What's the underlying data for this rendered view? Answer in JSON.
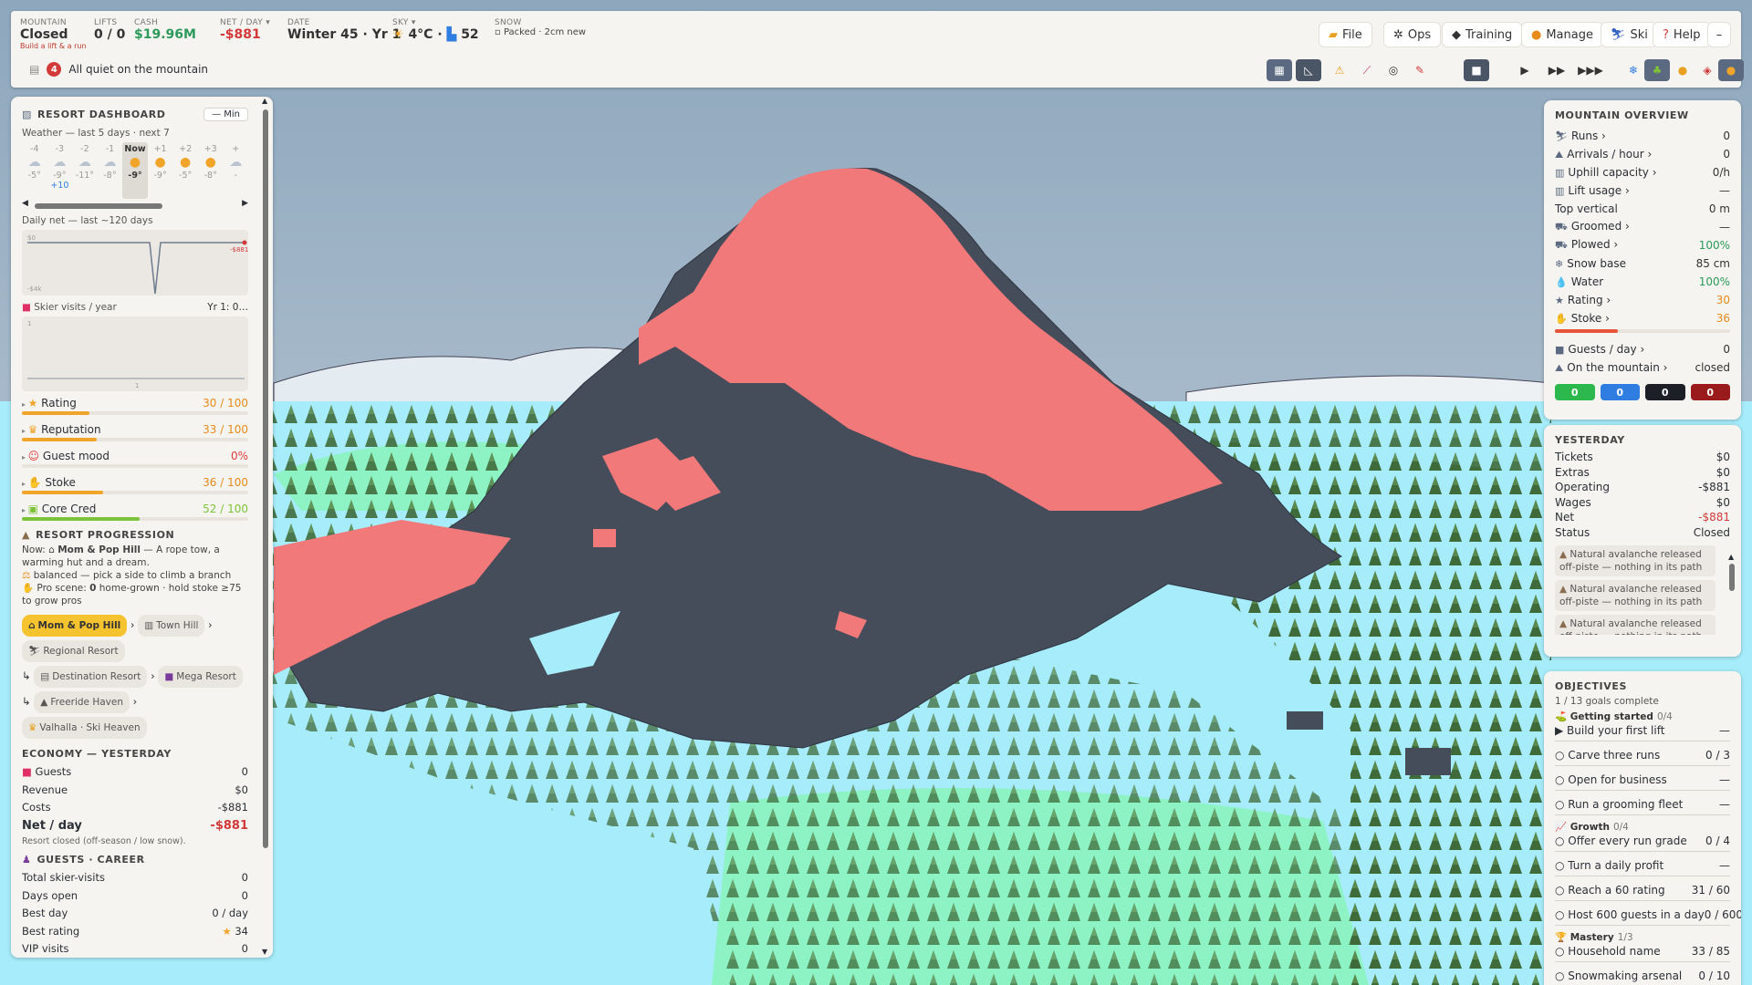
{
  "topbar": {
    "mountain": {
      "label": "MOUNTAIN",
      "value": "Closed",
      "sub": "Build a lift & a run"
    },
    "lifts": {
      "label": "LIFTS",
      "value": "0 / 0"
    },
    "cash": {
      "label": "CASH",
      "value": "$19.96M"
    },
    "net": {
      "label": "NET / DAY",
      "value": "-$881"
    },
    "date": {
      "label": "DATE",
      "value": "Winter 45 · Yr 1"
    },
    "sky": {
      "label": "SKY",
      "temp": "4°C",
      "extra": "52"
    },
    "snow": {
      "label": "SNOW",
      "value": "Packed · 2cm new"
    },
    "status_count": "4",
    "status_text": "All quiet on the mountain",
    "menus": [
      "File",
      "Ops",
      "Training",
      "Manage",
      "Ski",
      "Help"
    ],
    "minimize": "–"
  },
  "dashboard": {
    "title": "RESORT DASHBOARD",
    "min_button": "— Min",
    "weather_caption": "Weather — last 5 days · next 7",
    "weather_days": [
      {
        "day": "-4",
        "temp": "-5°"
      },
      {
        "day": "-3",
        "temp": "-9°"
      },
      {
        "day": "-2",
        "temp": "-11°"
      },
      {
        "day": "-1",
        "temp": "-8°"
      },
      {
        "day": "Now",
        "temp": "-9°"
      },
      {
        "day": "+1",
        "temp": "-9°"
      },
      {
        "day": "+2",
        "temp": "-5°"
      },
      {
        "day": "+3",
        "temp": "-8°"
      },
      {
        "day": "+",
        "temp": "-"
      }
    ],
    "weather_extra": "+10",
    "daily_net_caption": "Daily net — last ~120 days",
    "daily_net_top": "$0",
    "daily_net_bottom": "-$4k",
    "daily_net_last": "-$881",
    "visits_caption": "Skier visits / year",
    "visits_yr": "Yr 1: 0…",
    "visits_axis_top": "1",
    "visits_axis_bottom": "1",
    "meters": [
      {
        "name": "Rating",
        "value": "30 / 100",
        "pct": 0.3,
        "color": "#f0a52a",
        "icon": "★"
      },
      {
        "name": "Reputation",
        "value": "33 / 100",
        "pct": 0.33,
        "color": "#f0a52a",
        "icon": "♛"
      },
      {
        "name": "Guest mood",
        "value": "0%",
        "pct": 0.0,
        "color": "#e03b3b",
        "icon": "☺"
      },
      {
        "name": "Stoke",
        "value": "36 / 100",
        "pct": 0.36,
        "color": "#f0a52a",
        "icon": "✋"
      },
      {
        "name": "Core Cred",
        "value": "52 / 100",
        "pct": 0.52,
        "color": "#7cc33a",
        "icon": "▣"
      }
    ],
    "progression_title": "RESORT PROGRESSION",
    "progression_now_label": "Now:",
    "progression_now_name": "Mom & Pop Hill",
    "progression_now_desc": "— A rope tow, a warming hut and a dream.",
    "progression_balanced": "balanced — pick a side to climb a branch",
    "progression_pro_a": "Pro scene:",
    "progression_pro_b": "0",
    "progression_pro_c": "home-grown · hold stoke ≥75 to grow pros",
    "tiers": {
      "mom_pop": "Mom & Pop Hill",
      "town": "Town Hill",
      "regional": "Regional Resort",
      "destination": "Destination Resort",
      "mega": "Mega Resort",
      "freeride": "Freeride Haven",
      "valhalla": "Valhalla · Ski Heaven"
    },
    "economy_title": "ECONOMY — YESTERDAY",
    "economy": {
      "guests_label": "Guests",
      "guests": "0",
      "revenue_label": "Revenue",
      "revenue": "$0",
      "costs_label": "Costs",
      "costs": "-$881",
      "net_label": "Net / day",
      "net": "-$881"
    },
    "economy_note": "Resort closed (off-season / low snow).",
    "guests_title": "GUESTS · CAREER",
    "career": [
      {
        "label": "Total skier-visits",
        "value": "0"
      },
      {
        "label": "Days open",
        "value": "0"
      },
      {
        "label": "Best day",
        "value": "0 / day"
      },
      {
        "label": "Best rating",
        "value": "34"
      },
      {
        "label": "VIP visits",
        "value": "0"
      }
    ]
  },
  "overview": {
    "title": "MOUNTAIN OVERVIEW",
    "rows": [
      {
        "icon": "⛷",
        "label": "Runs ›",
        "value": "0"
      },
      {
        "icon": "⛰",
        "label": "Arrivals / hour ›",
        "value": "0"
      },
      {
        "icon": "▥",
        "label": "Uphill capacity ›",
        "value": "0/h"
      },
      {
        "icon": "▥",
        "label": "Lift usage ›",
        "value": "—"
      },
      {
        "icon": "",
        "label": "Top vertical",
        "value": "0 m"
      },
      {
        "icon": "⛟",
        "label": "Groomed ›",
        "value": "—"
      },
      {
        "icon": "⛟",
        "label": "Plowed ›",
        "value": "100%"
      },
      {
        "icon": "❄",
        "label": "Snow base",
        "value": "85 cm"
      },
      {
        "icon": "💧",
        "label": "Water",
        "value": "100%"
      },
      {
        "icon": "★",
        "label": "Rating ›",
        "value": "30"
      },
      {
        "icon": "✋",
        "label": "Stoke ›",
        "value": "36"
      }
    ],
    "stoke_pct": 0.36,
    "rows2": [
      {
        "icon": "■",
        "label": "Guests / day ›",
        "value": "0"
      },
      {
        "icon": "⛰",
        "label": "On the mountain ›",
        "value": "closed"
      }
    ],
    "pills": [
      {
        "value": "0",
        "color": "#2db84d"
      },
      {
        "value": "0",
        "color": "#2f7de0"
      },
      {
        "value": "0",
        "color": "#1c1f26"
      },
      {
        "value": "0",
        "color": "#9a1b1b"
      }
    ]
  },
  "yesterday": {
    "title": "YESTERDAY",
    "rows": [
      {
        "label": "Tickets",
        "value": "$0"
      },
      {
        "label": "Extras",
        "value": "$0"
      },
      {
        "label": "Operating",
        "value": "-$881"
      },
      {
        "label": "Wages",
        "value": "$0"
      },
      {
        "label": "Net",
        "value": "-$881"
      },
      {
        "label": "Status",
        "value": "Closed"
      }
    ],
    "log": [
      "Natural avalanche released off-piste — nothing in its path",
      "Natural avalanche released off-piste — nothing in its path",
      "Natural avalanche released off-piste — nothing in its path",
      "Natural avalanche released off-"
    ]
  },
  "objectives": {
    "title": "OBJECTIVES",
    "summary": "1 / 13 goals complete",
    "groups": [
      {
        "name": "Getting started",
        "count": "0/4",
        "icon": "⛳",
        "items": [
          {
            "label": "Build your first lift",
            "value": "—",
            "active": true
          },
          {
            "label": "Carve three runs",
            "value": "0 / 3"
          },
          {
            "label": "Open for business",
            "value": "—"
          },
          {
            "label": "Run a grooming fleet",
            "value": "—"
          }
        ]
      },
      {
        "name": "Growth",
        "count": "0/4",
        "icon": "📈",
        "items": [
          {
            "label": "Offer every run grade",
            "value": "0 / 4"
          },
          {
            "label": "Turn a daily profit",
            "value": "—"
          },
          {
            "label": "Reach a 60 rating",
            "value": "31 / 60"
          },
          {
            "label": "Host 600 guests in a day",
            "value": "0 / 600"
          }
        ]
      },
      {
        "name": "Mastery",
        "count": "1/3",
        "icon": "🏆",
        "items": [
          {
            "label": "Household name",
            "value": "33 / 85"
          },
          {
            "label": "Snowmaking arsenal",
            "value": "0 / 10"
          }
        ]
      }
    ]
  },
  "colors": {
    "run_red": "#f2797a",
    "rock": "#454c5a",
    "snow_blue": "#a6ecfa",
    "meadow": "#8df3c4",
    "sky": "#9fb6c8"
  }
}
